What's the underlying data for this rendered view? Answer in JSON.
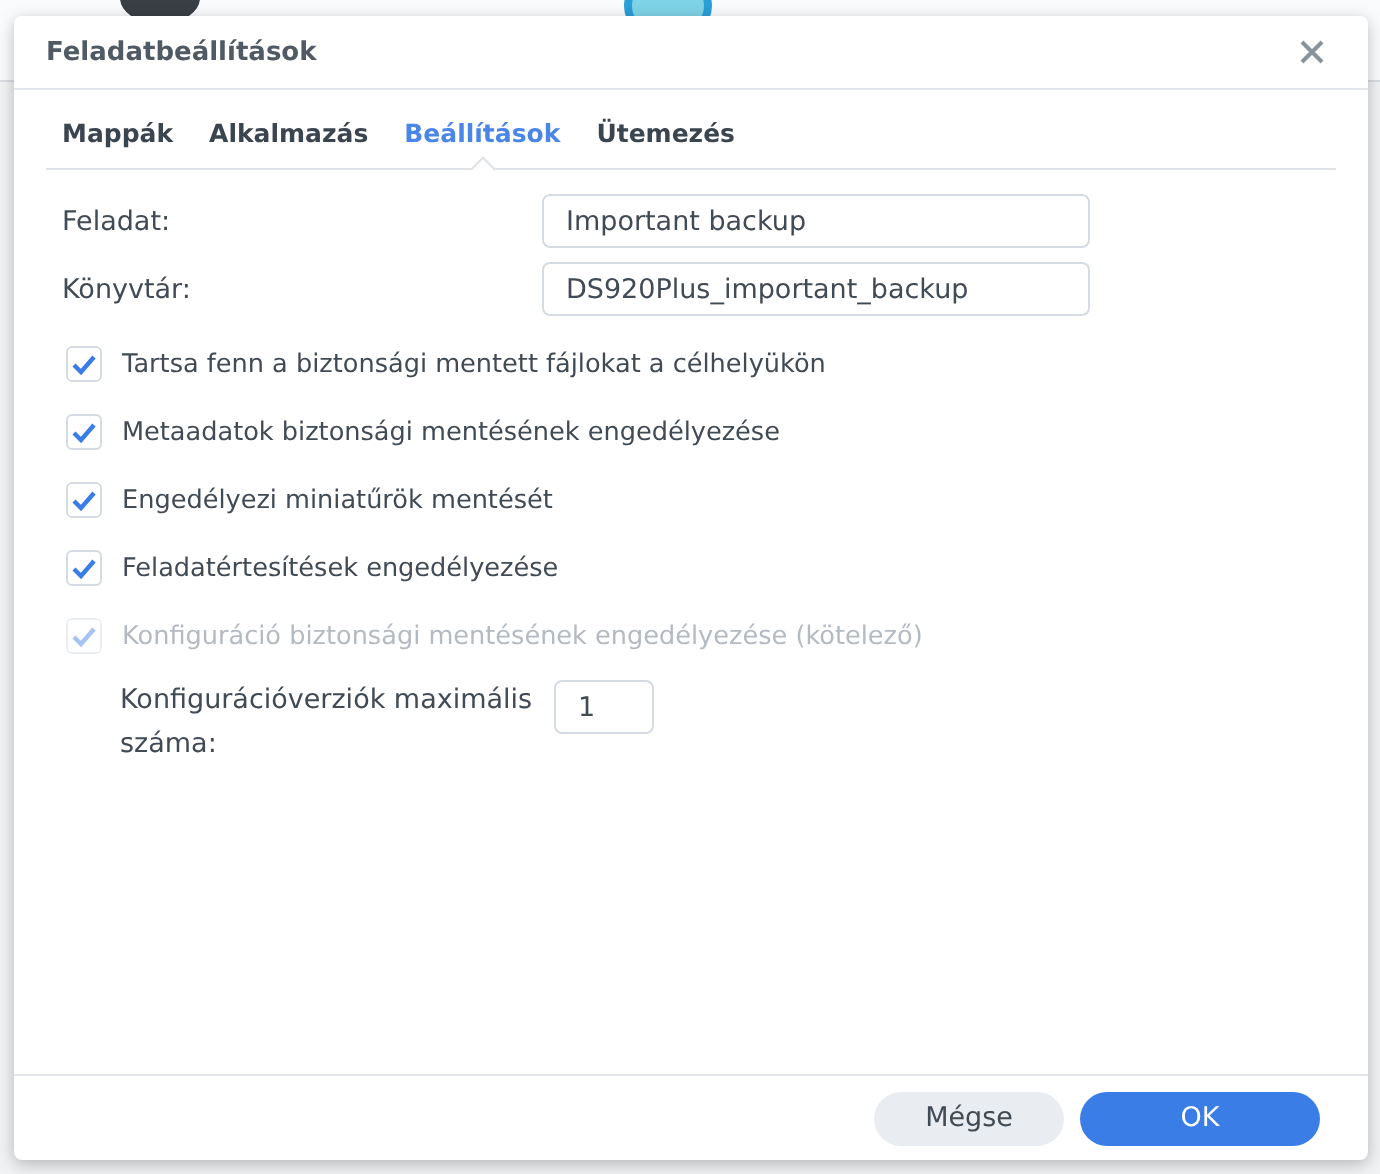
{
  "window": {
    "title": "Feladatbeállítások"
  },
  "tabs": [
    {
      "label": "Mappák",
      "selected": false
    },
    {
      "label": "Alkalmazás",
      "selected": false
    },
    {
      "label": "Beállítások",
      "selected": true
    },
    {
      "label": "Ütemezés",
      "selected": false
    }
  ],
  "fields": [
    {
      "label": "Feladat:",
      "value": "Important backup"
    },
    {
      "label": "Könyvtár:",
      "value": "DS920Plus_important_backup"
    }
  ],
  "options": [
    {
      "label": "Tartsa fenn a biztonsági mentett fájlokat a célhelyükön",
      "checked": true,
      "disabled": false
    },
    {
      "label": "Metaadatok biztonsági mentésének engedélyezése",
      "checked": true,
      "disabled": false
    },
    {
      "label": "Engedélyezi miniatűrök mentését",
      "checked": true,
      "disabled": false
    },
    {
      "label": "Feladatértesítések engedélyezése",
      "checked": true,
      "disabled": false
    },
    {
      "label": "Konfiguráció biztonsági mentésének engedélyezése (kötelező)",
      "checked": true,
      "disabled": true
    }
  ],
  "version_field": {
    "label": "Konfigurációverziók maximális száma:",
    "value": "1"
  },
  "buttons": [
    {
      "label": "Mégse",
      "kind": "secondary"
    },
    {
      "label": "OK",
      "kind": "primary"
    }
  ]
}
